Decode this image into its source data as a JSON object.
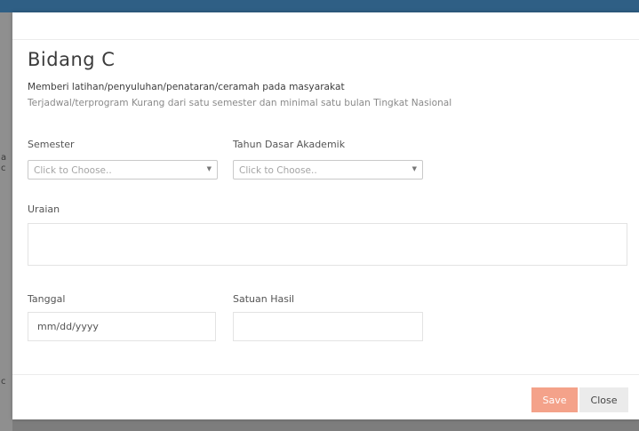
{
  "modal": {
    "title": "Bidang C",
    "description": "Memberi latihan/penyuluhan/penataran/ceramah pada masyarakat",
    "subdescription": "Terjadwal/terprogram Kurang dari satu semester dan minimal satu bulan Tingkat Nasional",
    "fields": {
      "semester": {
        "label": "Semester",
        "placeholder": "Click to Choose.."
      },
      "tahun": {
        "label": "Tahun Dasar Akademik",
        "placeholder": "Click to Choose.."
      },
      "uraian": {
        "label": "Uraian",
        "value": ""
      },
      "tanggal": {
        "label": "Tanggal",
        "placeholder": "mm/dd/yyyy"
      },
      "satuan": {
        "label": "Satuan Hasil",
        "value": ""
      }
    },
    "buttons": {
      "save": "Save",
      "close": "Close"
    }
  },
  "background": {
    "fragment1": "a",
    "fragment2": "c",
    "fragment3": "c"
  },
  "icons": {
    "caret": "caret-down-icon"
  },
  "colors": {
    "save_button": "#f4a28a",
    "header_bar": "#2f5f85"
  }
}
